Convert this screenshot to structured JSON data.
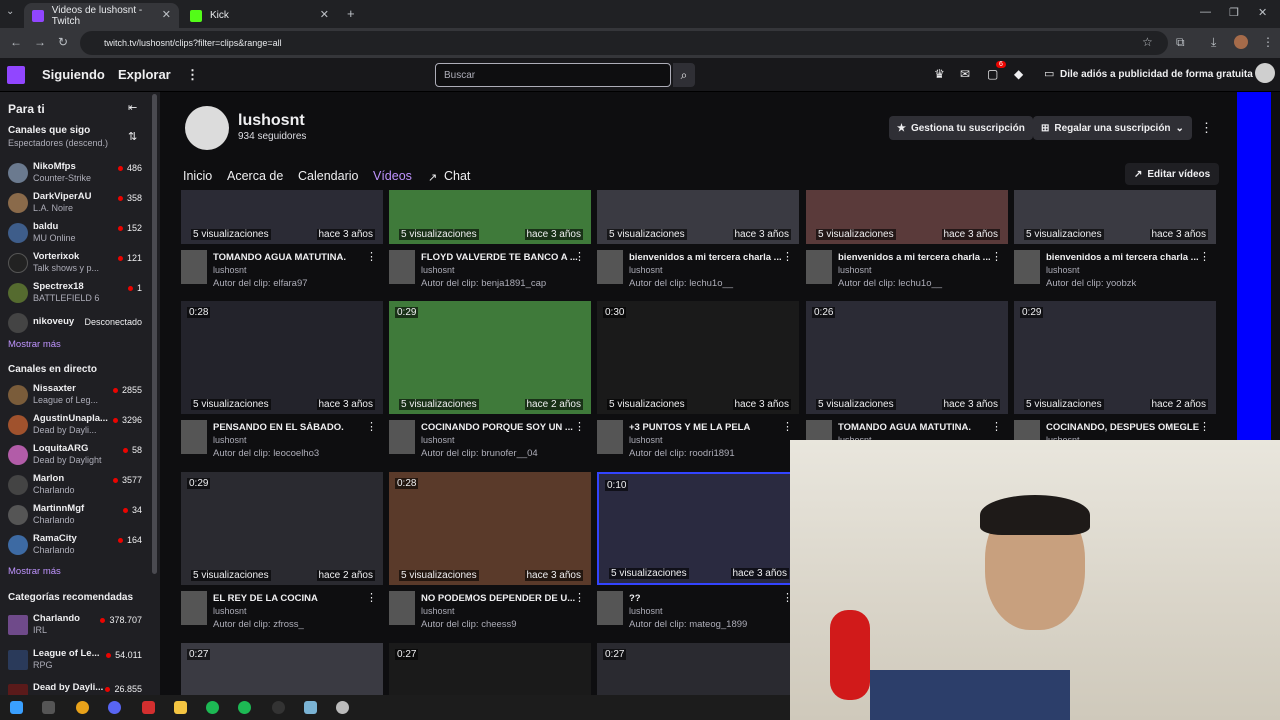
{
  "browser": {
    "tabs": [
      {
        "label": "Videos de lushosnt - Twitch",
        "active": true
      },
      {
        "label": "Kick",
        "active": false
      }
    ],
    "url": "twitch.tv/lushosnt/clips?filter=clips&range=all"
  },
  "topbar": {
    "following": "Siguiendo",
    "explore": "Explorar",
    "search_placeholder": "Buscar",
    "notif_count": "6",
    "ad_free": "Dile adiós a publicidad de forma gratuita"
  },
  "sidebar": {
    "for_you": "Para ti",
    "followed_title": "Canales que sigo",
    "followed_sort": "Espectadores (descend.)",
    "followed": [
      {
        "name": "NikoMfps",
        "game": "Counter-Strike",
        "viewers": "486",
        "color": "#6b7a8f"
      },
      {
        "name": "DarkViperAU",
        "game": "L.A. Noire",
        "viewers": "358",
        "color": "#8a6a4a"
      },
      {
        "name": "baldu",
        "game": "MU Online",
        "viewers": "152",
        "color": "#3e5d8a"
      },
      {
        "name": "Vorterixok",
        "game": "Talk shows y p...",
        "viewers": "121",
        "color": "#222"
      },
      {
        "name": "Spectrex18",
        "game": "BATTLEFIELD 6",
        "viewers": "1",
        "color": "#556b2f"
      }
    ],
    "offline": {
      "name": "nikoveuy",
      "status": "Desconectado"
    },
    "show_more_1": "Mostrar más",
    "live_title": "Canales en directo",
    "live": [
      {
        "name": "Nissaxter",
        "game": "League of Leg...",
        "viewers": "2855",
        "color": "#7a5c3a"
      },
      {
        "name": "AgustinUnapla...",
        "game": "Dead by Dayli...",
        "viewers": "3296",
        "color": "#a0522d"
      },
      {
        "name": "LoquitaARG",
        "game": "Dead by Daylight",
        "viewers": "58",
        "color": "#b25ca8"
      },
      {
        "name": "Marlon",
        "game": "Charlando",
        "viewers": "3577",
        "color": "#444"
      },
      {
        "name": "MartinnMgf",
        "game": "Charlando",
        "viewers": "34",
        "color": "#555"
      },
      {
        "name": "RamaCity",
        "game": "Charlando",
        "viewers": "164",
        "color": "#3d6aa3"
      }
    ],
    "show_more_2": "Mostrar más",
    "categories_title": "Categorías recomendadas",
    "categories": [
      {
        "name": "Charlando",
        "tag": "IRL",
        "viewers": "378.707",
        "color": "#6f4a8a"
      },
      {
        "name": "League of Le...",
        "tag": "RPG",
        "viewers": "54.011",
        "color": "#2a3a5a"
      },
      {
        "name": "Dead by Dayli...",
        "tag": "",
        "viewers": "26.855",
        "color": "#5a1a1a"
      }
    ]
  },
  "channel": {
    "name": "lushosnt",
    "followers": "934 seguidores",
    "manage_sub": "Gestiona tu suscripción",
    "gift_sub": "Regalar una suscripción",
    "edit_videos": "Editar vídeos"
  },
  "channel_tabs": [
    "Inicio",
    "Acerca de",
    "Calendario",
    "Vídeos",
    "Chat"
  ],
  "clips_row1": [
    {
      "dur": "",
      "views": "5 visualizaciones",
      "ago": "hace 3 años",
      "title": "TOMANDO AGUA MATUTINA.",
      "channel": "lushosnt",
      "author": "Autor del clip: elfara97",
      "color": "#2b2b35"
    },
    {
      "dur": "",
      "views": "5 visualizaciones",
      "ago": "hace 3 años",
      "title": "FLOYD VALVERDE TE BANCO A ...",
      "channel": "lushosnt",
      "author": "Autor del clip: benja1891_cap",
      "color": "#3f7a3a"
    },
    {
      "dur": "",
      "views": "5 visualizaciones",
      "ago": "hace 3 años",
      "title": "bienvenidos a mi tercera charla ...",
      "channel": "lushosnt",
      "author": "Autor del clip: lechu1o__",
      "color": "#3a3a42"
    },
    {
      "dur": "",
      "views": "5 visualizaciones",
      "ago": "hace 3 años",
      "title": "bienvenidos a mi tercera charla ...",
      "channel": "lushosnt",
      "author": "Autor del clip: lechu1o__",
      "color": "#5a3a3a"
    },
    {
      "dur": "",
      "views": "5 visualizaciones",
      "ago": "hace 3 años",
      "title": "bienvenidos a mi tercera charla ...",
      "channel": "lushosnt",
      "author": "Autor del clip: yoobzk",
      "color": "#3a3a42"
    }
  ],
  "clips_row2": [
    {
      "dur": "0:28",
      "views": "5 visualizaciones",
      "ago": "hace 3 años",
      "title": "PENSANDO EN EL SÁBADO.",
      "channel": "lushosnt",
      "author": "Autor del clip: leocoelho3",
      "color": "#23232b"
    },
    {
      "dur": "0:29",
      "views": "5 visualizaciones",
      "ago": "hace 2 años",
      "title": "COCINANDO PORQUE SOY UN ...",
      "channel": "lushosnt",
      "author": "Autor del clip: brunofer__04",
      "color": "#3f7a3a"
    },
    {
      "dur": "0:30",
      "views": "5 visualizaciones",
      "ago": "hace 3 años",
      "title": "+3 PUNTOS Y ME LA PELA",
      "channel": "lushosnt",
      "author": "Autor del clip: roodri1891",
      "color": "#1a1a1a"
    },
    {
      "dur": "0:26",
      "views": "5 visualizaciones",
      "ago": "hace 3 años",
      "title": "TOMANDO AGUA MATUTINA.",
      "channel": "lushosnt",
      "author": "",
      "color": "#2b2b35"
    },
    {
      "dur": "0:29",
      "views": "5 visualizaciones",
      "ago": "hace 2 años",
      "title": "COCINANDO, DESPUES OMEGLE",
      "channel": "lushosnt",
      "author": "",
      "color": "#2b2b35"
    }
  ],
  "clips_row3": [
    {
      "dur": "0:29",
      "views": "5 visualizaciones",
      "ago": "hace 2 años",
      "title": "EL REY DE LA COCINA",
      "channel": "lushosnt",
      "author": "Autor del clip: zfross_",
      "color": "#2a2a30"
    },
    {
      "dur": "0:28",
      "views": "5 visualizaciones",
      "ago": "hace 3 años",
      "title": "NO PODEMOS DEPENDER DE U...",
      "channel": "lushosnt",
      "author": "Autor del clip: cheess9",
      "color": "#5a3a2a"
    },
    {
      "dur": "0:10",
      "views": "5 visualizaciones",
      "ago": "hace 3 años",
      "title": "??",
      "channel": "lushosnt",
      "author": "Autor del clip: mateog_1899",
      "color": "#2a2a40"
    }
  ],
  "clips_row4": [
    {
      "dur": "0:27",
      "color": "#3a3a42"
    },
    {
      "dur": "0:27",
      "color": "#1a1a1a"
    },
    {
      "dur": "0:27",
      "color": "#2a2a30"
    }
  ]
}
